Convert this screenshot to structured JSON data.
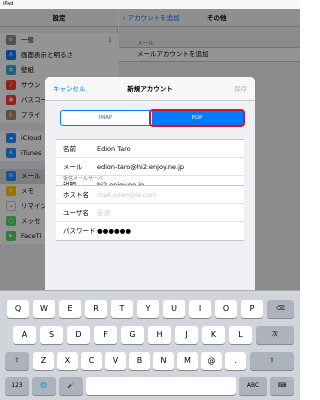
{
  "status_bar": {
    "device": "iPad",
    "time": "",
    "battery": ""
  },
  "sidebar": {
    "title": "設定",
    "items": [
      {
        "label": "一般",
        "badge": "1",
        "icon_color": "#8e8e93"
      },
      {
        "label": "画面表示と明るさ",
        "icon_color": "#007aff"
      },
      {
        "label": "壁紙",
        "icon_color": "#35aadc"
      },
      {
        "label": "サウン",
        "icon_color": "#ff3b30"
      },
      {
        "label": "パスコー",
        "icon_color": "#ff3b30"
      },
      {
        "label": "プライ",
        "icon_color": "#8e8e93"
      },
      {
        "label": "iCloud",
        "icon_color": "#1e90ff"
      },
      {
        "label": "iTunes",
        "icon_color": "#1e90ff"
      },
      {
        "label": "メール",
        "icon_color": "#1e90ff",
        "selected": true
      },
      {
        "label": "メモ",
        "icon_color": "#ffcc00"
      },
      {
        "label": "リマイン",
        "icon_color": "#ffffff"
      },
      {
        "label": "メッセ",
        "icon_color": "#4cd964"
      },
      {
        "label": "FaceTi",
        "icon_color": "#4cd964"
      }
    ]
  },
  "main": {
    "back_label": "アカウントを追加",
    "title": "その他",
    "group_label": "メール",
    "row_label": "メールアカウントを追加"
  },
  "modal": {
    "cancel_label": "キャンセル",
    "title": "新規アカウント",
    "save_label": "保存",
    "segments": [
      "IMAP",
      "POP"
    ],
    "selected_segment": "POP",
    "account_fields": [
      {
        "label": "名前",
        "value": "Edion Taro"
      },
      {
        "label": "メール",
        "value": "edion-taro@hi2.enjoy.ne.jp"
      },
      {
        "label": "説明",
        "value": "hi2.enjoy.ne.jp"
      }
    ],
    "incoming_label": "受信メールサーバ",
    "server_fields": [
      {
        "label": "ホスト名",
        "value": "",
        "placeholder": "mail.example.com"
      },
      {
        "label": "ユーザ名",
        "value": "",
        "placeholder": "必須"
      },
      {
        "label": "パスワード",
        "value": "●●●●●●",
        "placeholder": ""
      }
    ]
  },
  "keyboard": {
    "row1": [
      "Q",
      "W",
      "E",
      "R",
      "T",
      "Y",
      "U",
      "I",
      "O",
      "P"
    ],
    "row2": [
      "A",
      "S",
      "D",
      "F",
      "G",
      "H",
      "J",
      "K",
      "L"
    ],
    "row3": [
      "Z",
      "X",
      "C",
      "V",
      "B",
      "N",
      "M",
      "@",
      "."
    ],
    "num_key": "123",
    "abc_key": "ABC",
    "next_key": "次",
    "shift_glyph": "⇧",
    "delete_glyph": "⌫",
    "globe_glyph": "🌐",
    "mic_glyph": "🎤",
    "hide_glyph": "⌨"
  },
  "colors": {
    "accent": "#007aff",
    "highlight": "#d0142c"
  }
}
